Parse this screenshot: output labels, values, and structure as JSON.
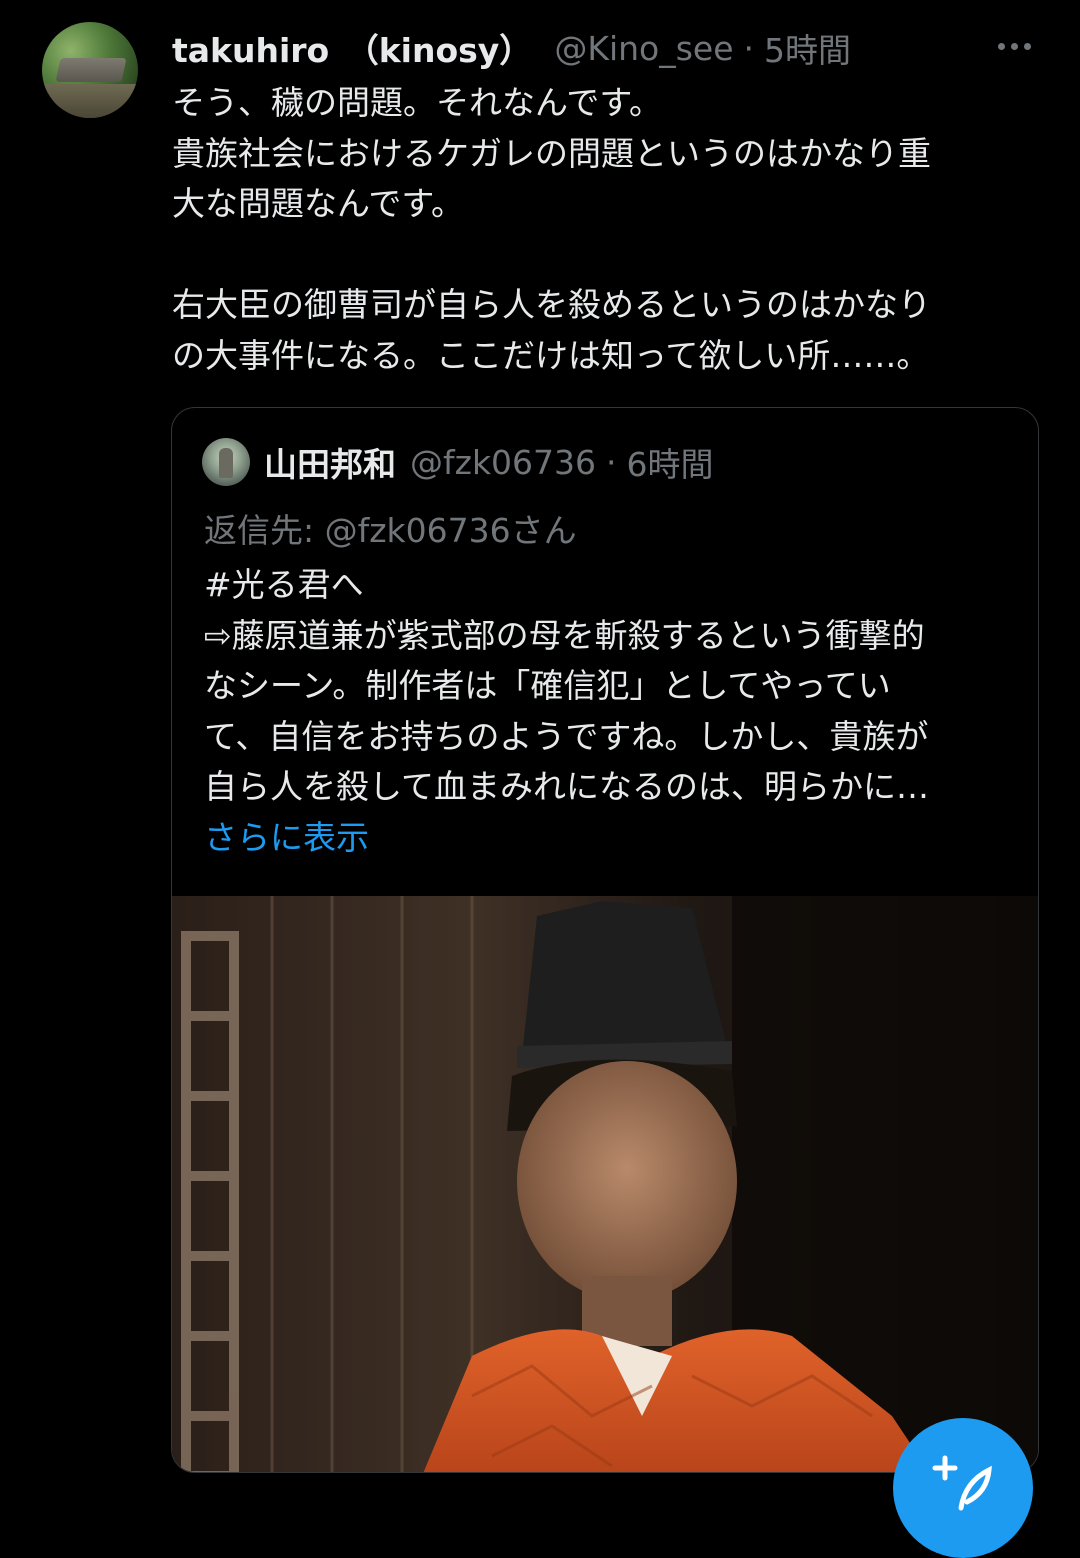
{
  "tweet": {
    "display_name": "takuhiro　（kinosy）",
    "handle": "@Kino_see",
    "separator": "·",
    "time": "5時間",
    "lines": [
      "そう、穢の問題。それなんです。",
      "貴族社会におけるケガレの問題というのはかなり重",
      "大な問題なんです。",
      "",
      "右大臣の御曹司が自ら人を殺めるというのはかなり",
      "の大事件になる。ここだけは知って欲しい所……。"
    ]
  },
  "quote": {
    "display_name": "山田邦和",
    "handle": "@fzk06736",
    "separator": "·",
    "time": "6時間",
    "reply_to": "返信先: @fzk06736さん",
    "lines": [
      "#光る君へ",
      "⇨藤原道兼が紫式部の母を斬殺するという衝撃的",
      "なシーン。制作者は「確信犯」としてやってい",
      "て、自信をお持ちのようですね。しかし、貴族が",
      "自ら人を殺して血まみれになるのは、明らかに…"
    ],
    "show_more": "さらに表示"
  },
  "icons": {
    "more": "more-horizontal-icon",
    "compose": "compose-tweet-icon"
  },
  "colors": {
    "background": "#000000",
    "text": "#e7e9ea",
    "secondary": "#71767b",
    "accent": "#1d9bf0",
    "border": "#333639"
  }
}
